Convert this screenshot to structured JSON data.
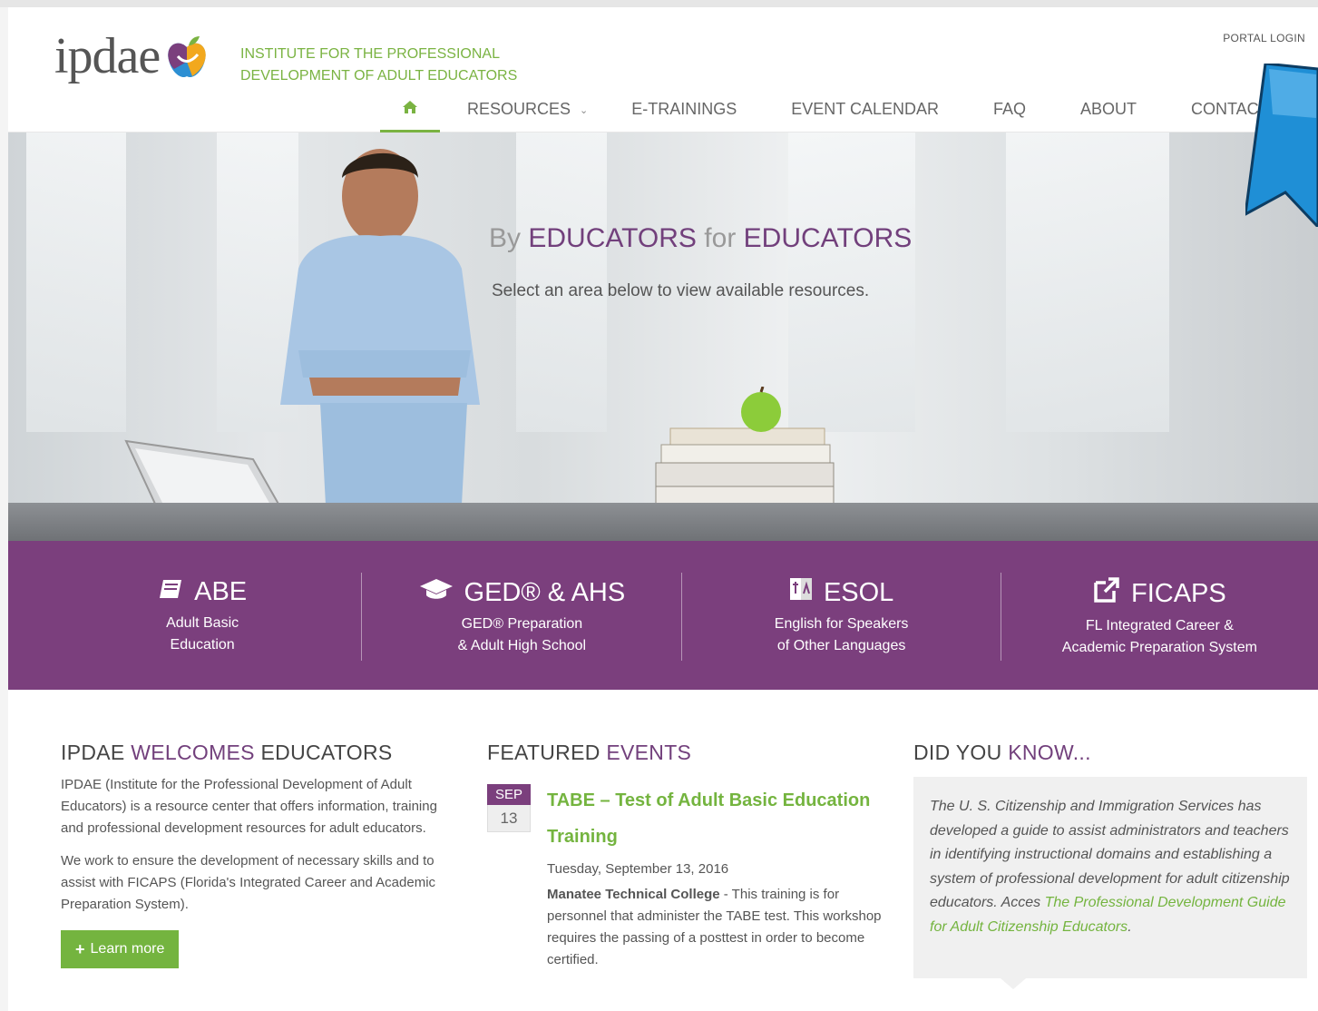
{
  "header": {
    "logo_text": "ipdae",
    "tagline_line1": "INSTITUTE FOR THE PROFESSIONAL",
    "tagline_line2": "DEVELOPMENT OF ADULT EDUCATORS",
    "portal_login": "PORTAL LOGIN"
  },
  "nav": {
    "home_icon": "home-icon",
    "items": [
      "RESOURCES",
      "E-TRAININGS",
      "EVENT CALENDAR",
      "FAQ",
      "ABOUT",
      "CONTAC"
    ]
  },
  "hero": {
    "title_by": "By",
    "title_educators1": "EDUCATORS",
    "title_for": "for",
    "title_educators2": "EDUCATORS",
    "subtitle": "Select an area below to view available resources."
  },
  "categories": [
    {
      "icon": "book-icon",
      "title": "ABE",
      "line1": "Adult Basic",
      "line2": "Education"
    },
    {
      "icon": "graduation-cap-icon",
      "title": "GED® & AHS",
      "line1": "GED® Preparation",
      "line2": "& Adult High School"
    },
    {
      "icon": "language-icon",
      "title": "ESOL",
      "line1": "English for Speakers",
      "line2": "of Other Languages"
    },
    {
      "icon": "external-link-icon",
      "title": "FICAPS",
      "line1": "FL Integrated Career &",
      "line2": "Academic Preparation System"
    }
  ],
  "welcome": {
    "h_part1": "IPDAE",
    "h_part2": "WELCOMES",
    "h_part3": "EDUCATORS",
    "para1": "IPDAE (Institute for the Professional Development of Adult Educators) is a resource center that offers information, training and professional development resources for adult educators.",
    "para2": "We work to ensure the development of necessary skills and to assist with FICAPS (Florida's Integrated Career and Academic Preparation System).",
    "button": "Learn more"
  },
  "events": {
    "h_part1": "FEATURED",
    "h_part2": "EVENTS",
    "month": "SEP",
    "day": "13",
    "title": "TABE – Test of Adult Basic Education Training",
    "date": "Tuesday, September 13, 2016",
    "location": "Manatee Technical College",
    "desc": " - This training is for personnel that administer the TABE test. This workshop requires the passing of a posttest in order to become certified."
  },
  "know": {
    "h_part1": "DID YOU",
    "h_part2": "KNOW...",
    "text": "The U. S. Citizenship and Immigration Services has developed a guide to assist administrators and teachers in identifying instructional domains and establishing a system of professional development for adult citizenship educators.  Acces ",
    "link": "The Professional Development Guide for Adult Citizenship Educators",
    "end": "."
  },
  "colors": {
    "purple": "#7b3f7d",
    "green": "#74b43f",
    "arrow_blue": "#1f8fd6"
  }
}
